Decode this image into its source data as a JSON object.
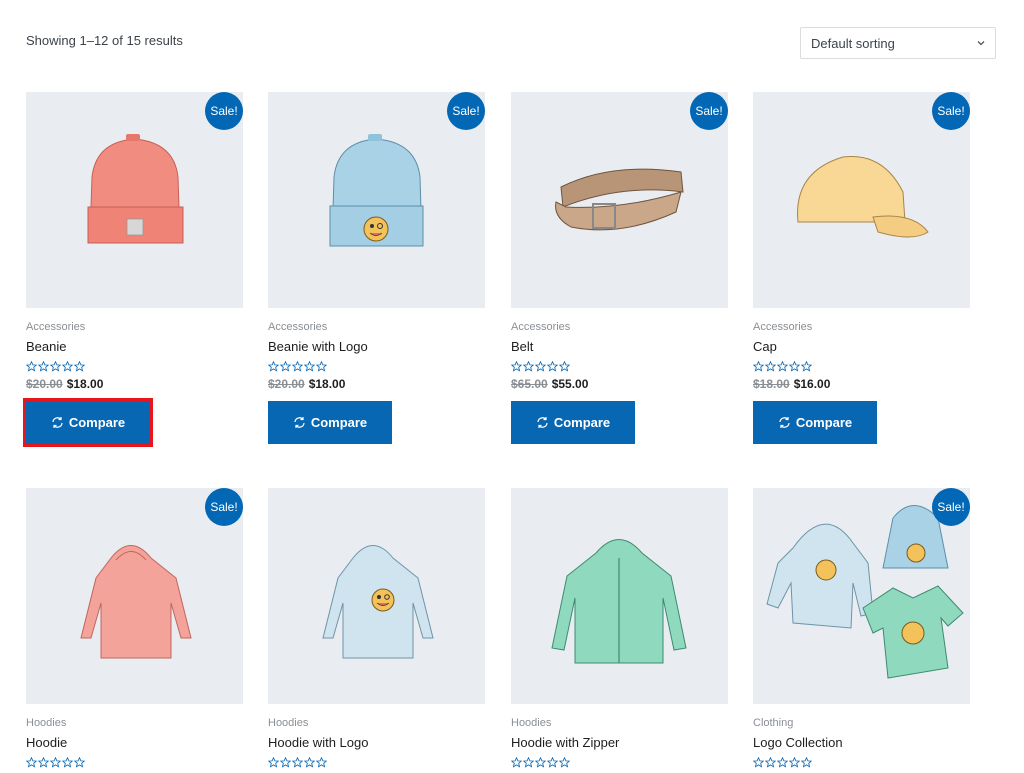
{
  "result_count": "Showing 1–12 of 15 results",
  "sorting": {
    "selected": "Default sorting"
  },
  "sale_badge": "Sale!",
  "compare_label": "Compare",
  "products": [
    {
      "category": "Accessories",
      "name": "Beanie",
      "old_price": "$20.00",
      "price": "$18.00",
      "rating": 0
    },
    {
      "category": "Accessories",
      "name": "Beanie with Logo",
      "old_price": "$20.00",
      "price": "$18.00",
      "rating": 0
    },
    {
      "category": "Accessories",
      "name": "Belt",
      "old_price": "$65.00",
      "price": "$55.00",
      "rating": 0
    },
    {
      "category": "Accessories",
      "name": "Cap",
      "old_price": "$18.00",
      "price": "$16.00",
      "rating": 0
    },
    {
      "category": "Hoodies",
      "name": "Hoodie"
    },
    {
      "category": "Hoodies",
      "name": "Hoodie with Logo"
    },
    {
      "category": "Hoodies",
      "name": "Hoodie with Zipper"
    },
    {
      "category": "Clothing",
      "name": "Logo Collection"
    }
  ],
  "colors": {
    "accent": "#0867b3",
    "thumb_bg": "#e9edf1",
    "highlight": "#e6161c"
  }
}
